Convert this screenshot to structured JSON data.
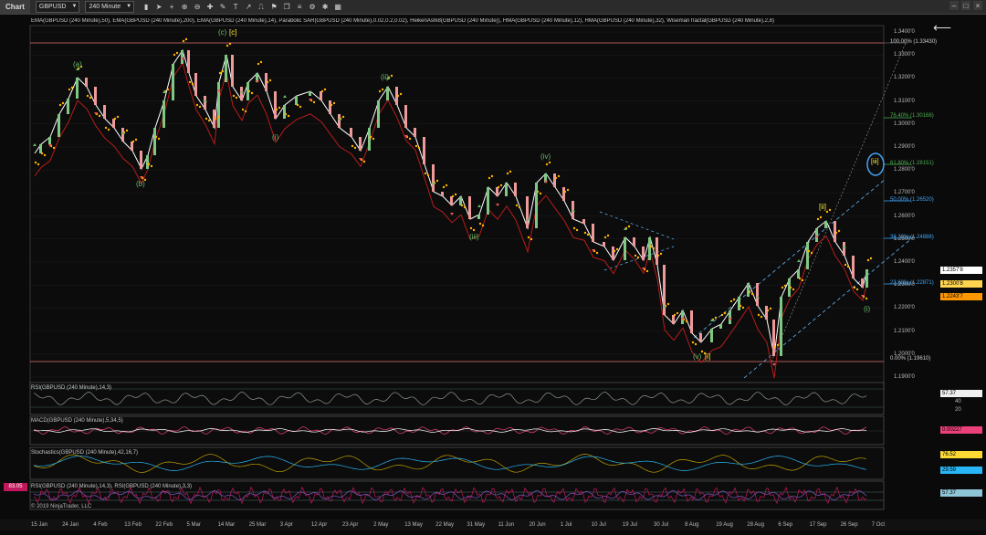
{
  "toolbar": {
    "title": "Chart",
    "instrument": "GBPUSD",
    "timeframe": "240 Minute",
    "tool_icons": [
      "bar-chart-icon",
      "cursor-icon",
      "crosshair-icon",
      "zoom-in-icon",
      "zoom-out-icon",
      "plus-icon",
      "pencil-icon",
      "text-icon",
      "arrow-icon",
      "ruler-icon",
      "flag-icon",
      "bookmark-icon",
      "list-icon",
      "gear-icon",
      "settings-icon",
      "grid-icon"
    ]
  },
  "main_panel": {
    "indicator_label": "EMA(GBPUSD (240 Minute),50), EMA(GBPUSD (240 Minute),200), EMA(GBPUSD (240 Minute),14), Parabolic SAR(GBPUSD (240 Minute),0.02,0.2,0.02), HeikenAshi8(GBPUSD (240 Minute)), HMA(GBPUSD (240 Minute),12), HMA(GBPUSD (240 Minute),32), Wiseman fractal(GBPUSD (240 Minute),2,8)",
    "y_ticks": [
      "1.3400'0",
      "1.3300'0",
      "1.3200'0",
      "1.3100'0",
      "1.3000'0",
      "1.2900'0",
      "1.2800'0",
      "1.2700'0",
      "1.2600'0",
      "1.2500'0",
      "1.2400'0",
      "1.2300'0",
      "1.2200'0",
      "1.2100'0",
      "1.2000'0",
      "1.1900'0"
    ],
    "fib_levels": [
      {
        "label": "100.00% (1.33430)",
        "color": "#d0d0d0"
      },
      {
        "label": "61.80% (1.28151)",
        "color": "#4caf50"
      },
      {
        "label": "76.40% (1.30168)",
        "color": "#4caf50"
      },
      {
        "label": "50.00% (1.26520)",
        "color": "#42a5f5"
      },
      {
        "label": "38.20% (1.24888)",
        "color": "#42a5f5"
      },
      {
        "label": "23.60% (1.22871)",
        "color": "#42a5f5"
      },
      {
        "label": "0.00% (1.19610)",
        "color": "#d0d0d0"
      }
    ],
    "wave_labels": [
      "(a)",
      "(b)",
      "(c)",
      "[c]",
      "(i)",
      "(ii)",
      "(iii)",
      "(iv)",
      "(v)",
      "[i]",
      "[ii]",
      "(i)"
    ],
    "circled_label": "[iii]",
    "price_badges": [
      {
        "value": "1.2357'8",
        "color": "#ffffff"
      },
      {
        "value": "1.2300'8",
        "color": "#ffd54f"
      },
      {
        "value": "1.2243'7",
        "color": "#ff9800"
      }
    ]
  },
  "rsi_panel": {
    "label": "RSI(GBPUSD (240 Minute),14,3)",
    "value": "57.37",
    "ticks": [
      "40",
      "20"
    ]
  },
  "macd_panel": {
    "label": "MACD(GBPUSD (240 Minute),5,34,5)",
    "value": "0.00227"
  },
  "stoch_panel": {
    "label": "Stochastics(GBPUSD (240 Minute),42,16,7)",
    "values": [
      "76.52",
      "29.59"
    ]
  },
  "rsi2_panel": {
    "label": "RSI(GBPUSD (240 Minute),14,3), RSI(GBPUSD (240 Minute),3,3)",
    "left_value": "83.05",
    "value": "57.37"
  },
  "copyright": "© 2019 NinjaTrader, LLC",
  "x_axis": [
    "15 Jan",
    "24 Jan",
    "4 Feb",
    "13 Feb",
    "22 Feb",
    "5 Mar",
    "14 Mar",
    "25 Mar",
    "3 Apr",
    "12 Apr",
    "23 Apr",
    "2 May",
    "13 May",
    "22 May",
    "31 May",
    "11 Jun",
    "20 Jun",
    "1 Jul",
    "10 Jul",
    "19 Jul",
    "30 Jul",
    "8 Aug",
    "19 Aug",
    "28 Aug",
    "6 Sep",
    "17 Sep",
    "26 Sep",
    "7 Oct"
  ],
  "colors": {
    "ema50": "#b71c1c",
    "heiken_bull": "#81c784",
    "sar": "#ffb300",
    "channel": "#64b5f6",
    "rsi": "#8d9a8d",
    "stoch_k": "#c0a000",
    "stoch_d": "#29b6f6",
    "rsi2": "#c2185b"
  }
}
